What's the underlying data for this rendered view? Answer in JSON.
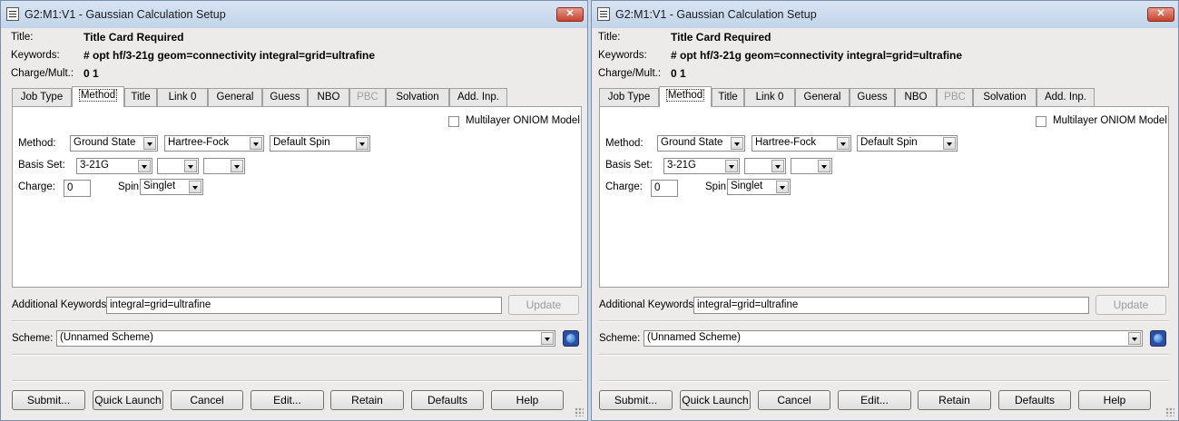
{
  "windows": [
    {
      "title": "G2:M1:V1 - Gaussian Calculation Setup",
      "close": "✕",
      "title_label": "Title:",
      "title_value": "Title Card Required",
      "keywords_label": "Keywords:",
      "keywords_value": "# opt hf/3-21g geom=connectivity integral=grid=ultrafine",
      "charge_mult_label": "Charge/Mult.:",
      "charge_mult_value": "0 1",
      "tabs": [
        "Job Type",
        "Method",
        "Title",
        "Link 0",
        "General",
        "Guess",
        "NBO",
        "PBC",
        "Solvation",
        "Add. Inp."
      ],
      "active_tab": "Method",
      "disabled_tab": "PBC",
      "oniom_label": "Multilayer ONIOM Model",
      "method_label": "Method:",
      "method_state": "Ground State",
      "method_type": "Hartree-Fock",
      "method_spin": "Default Spin",
      "basis_label": "Basis Set:",
      "basis_value": "3-21G",
      "basis_opt1": "",
      "basis_opt2": "",
      "charge_label": "Charge:",
      "charge_value": "0",
      "spin_label": "Spin:",
      "spin_value": "Singlet",
      "addkw_label": "Additional Keywords:",
      "addkw_value": "integral=grid=ultrafine",
      "update_label": "Update",
      "scheme_label": "Scheme:",
      "scheme_value": "(Unnamed Scheme)",
      "buttons": {
        "submit": "Submit...",
        "quick_launch": "Quick Launch",
        "cancel": "Cancel",
        "edit": "Edit...",
        "retain": "Retain",
        "defaults": "Defaults",
        "help": "Help"
      }
    },
    {
      "title": "G2:M1:V1 - Gaussian Calculation Setup",
      "close": "✕",
      "title_label": "Title:",
      "title_value": "Title Card Required",
      "keywords_label": "Keywords:",
      "keywords_value": "# opt hf/3-21g geom=connectivity integral=grid=ultrafine",
      "charge_mult_label": "Charge/Mult.:",
      "charge_mult_value": "0 1",
      "tabs": [
        "Job Type",
        "Method",
        "Title",
        "Link 0",
        "General",
        "Guess",
        "NBO",
        "PBC",
        "Solvation",
        "Add. Inp."
      ],
      "active_tab": "Method",
      "disabled_tab": "PBC",
      "oniom_label": "Multilayer ONIOM Model",
      "method_label": "Method:",
      "method_state": "Ground State",
      "method_type": "Hartree-Fock",
      "method_spin": "Default Spin",
      "basis_label": "Basis Set:",
      "basis_value": "3-21G",
      "basis_opt1": "",
      "basis_opt2": "",
      "charge_label": "Charge:",
      "charge_value": "0",
      "spin_label": "Spin:",
      "spin_value": "Singlet",
      "addkw_label": "Additional Keywords:",
      "addkw_value": "integral=grid=ultrafine",
      "update_label": "Update",
      "scheme_label": "Scheme:",
      "scheme_value": "(Unnamed Scheme)",
      "buttons": {
        "submit": "Submit...",
        "quick_launch": "Quick Launch",
        "cancel": "Cancel",
        "edit": "Edit...",
        "retain": "Retain",
        "defaults": "Defaults",
        "help": "Help"
      }
    }
  ]
}
